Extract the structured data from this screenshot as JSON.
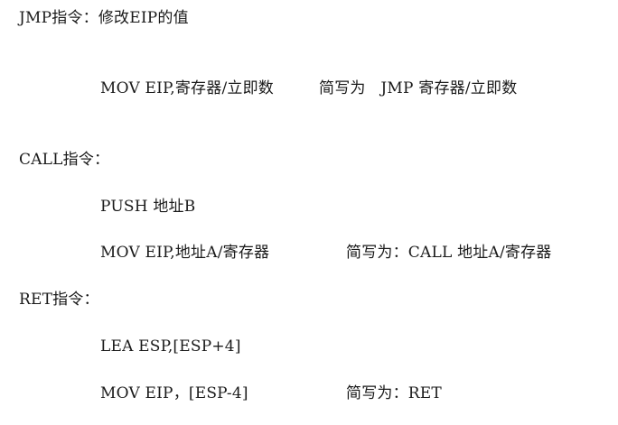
{
  "sections": [
    {
      "heading": "JMP指令：修改EIP的值",
      "lines": [
        {
          "code": "MOV EIP,寄存器/立即数",
          "note": "简写为   JMP 寄存器/立即数"
        }
      ]
    },
    {
      "heading": "CALL指令：",
      "lines": [
        {
          "code": "PUSH 地址B",
          "note": ""
        },
        {
          "code": "MOV EIP,地址A/寄存器",
          "note": "简写为：CALL 地址A/寄存器"
        }
      ]
    },
    {
      "heading": "RET指令：",
      "lines": [
        {
          "code": "LEA ESP,[ESP+4]",
          "note": ""
        },
        {
          "code": "MOV EIP，[ESP-4]",
          "note": "简写为：RET"
        }
      ]
    }
  ]
}
